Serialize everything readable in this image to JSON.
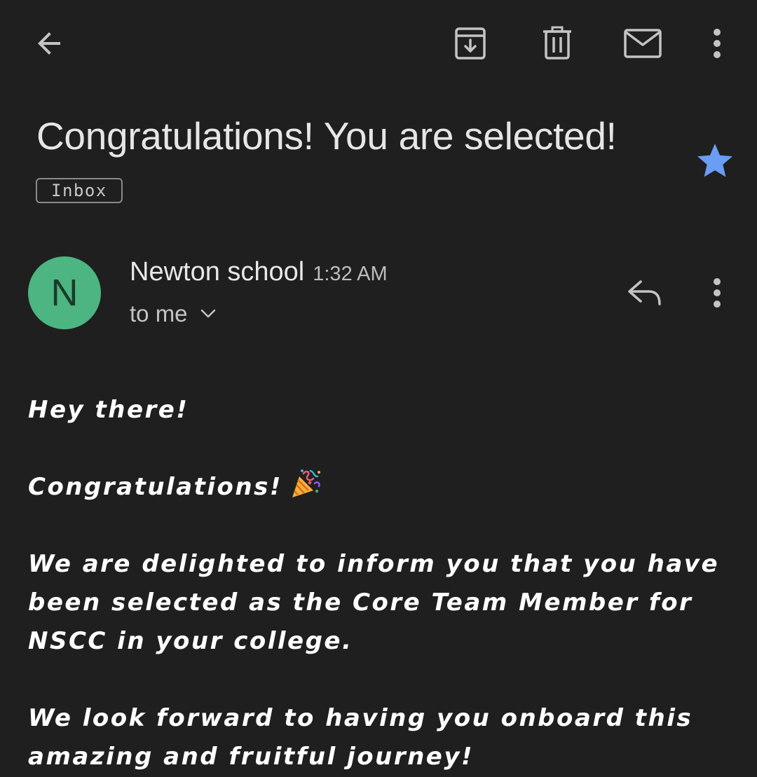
{
  "toolbar": {
    "back_icon": "arrow-back-icon",
    "archive_icon": "archive-icon",
    "delete_icon": "trash-icon",
    "mark_unread_icon": "mail-icon",
    "more_icon": "more-vert-icon"
  },
  "email": {
    "subject": "Congratulations! You are selected!",
    "label": "Inbox",
    "starred": true,
    "star_color": "#6a9ef5",
    "sender": {
      "initial": "N",
      "avatar_color": "#4cb582",
      "name": "Newton school",
      "time": "1:32 AM",
      "recipient": "to me"
    },
    "body": {
      "greeting": "Hey there!",
      "congrats": "Congratulations!",
      "congrats_emoji": "party-popper-icon",
      "paragraph1": "We are delighted to inform you that you have been selected as the Core Team Member for NSCC in your college.",
      "paragraph2": "We look forward to having you onboard this amazing and fruitful journey!"
    }
  }
}
